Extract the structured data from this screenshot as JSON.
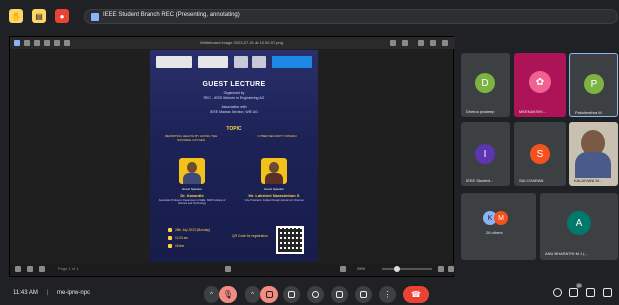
{
  "meeting": {
    "presenting_label": "IEEE Student Branch REC (Presenting, annotating)",
    "clock": "11:43 AM",
    "separator": "|",
    "code": "me-iprw-npc"
  },
  "presentation": {
    "window_title": "Whiteboard image 2023-07-21 at 10.50.57.png",
    "page_info": "Page 1 of 1",
    "zoom": "29%"
  },
  "poster": {
    "title": "GUEST LECTURE",
    "organized_by_label": "Organized by",
    "organizer": "REC - IEEE Women in Engineering AG",
    "association_label": "Association with",
    "associate": "IEEE Madras Section, WIE AG",
    "topic_label": "TOPIC",
    "topic_left": "REWRITING HEALTH BY GIVING THE SUITABLE OXYGEN",
    "topic_right": "CYBER SECURITY DOMAIN",
    "speakers": [
      {
        "tag": "Guest Speaker",
        "name": "Dr. Kasanthi",
        "desc": "Associate Professor, Department of EEE, SRM Institute of Science and Technology"
      },
      {
        "tag": "Guest Speaker",
        "name": "Mr. Lakshmi Narasimhan S",
        "desc": "Vice President, Intellect Design Arena Ltd, Chennai"
      }
    ],
    "date": "26th July 2023 (Monday)",
    "time": "11:00 am",
    "mode": "Online",
    "qr_label": "QR Code for registration"
  },
  "participants": [
    {
      "initial": "D",
      "name": "Dheina pradeep",
      "color": "#7cb342"
    },
    {
      "initial": "",
      "name": "MEENAKSHI...",
      "color": "#ad1457"
    },
    {
      "initial": "P",
      "name": "Pakshesthra M",
      "color": "#7cb342"
    },
    {
      "initial": "I",
      "name": "IEEE Student...",
      "color": "#5e35b1"
    },
    {
      "initial": "S",
      "name": "SAI CHARAN",
      "color": "#f4511e"
    },
    {
      "initial": "",
      "name": "KALAIVANI M...",
      "color": "#c8c0b0"
    },
    {
      "initial": "",
      "name": "26 others",
      "color": "#3c4043"
    },
    {
      "initial": "A",
      "name": "ANU BHARATHI M J (...",
      "color": "#00796b"
    }
  ],
  "others_avatars": [
    "K",
    "M"
  ],
  "participant_count": "30",
  "colors": {
    "background": "#202124",
    "tile": "#3c4043",
    "hangup": "#ea4335",
    "mic_off": "#f28b82",
    "accent_yellow": "#ffd24a"
  }
}
